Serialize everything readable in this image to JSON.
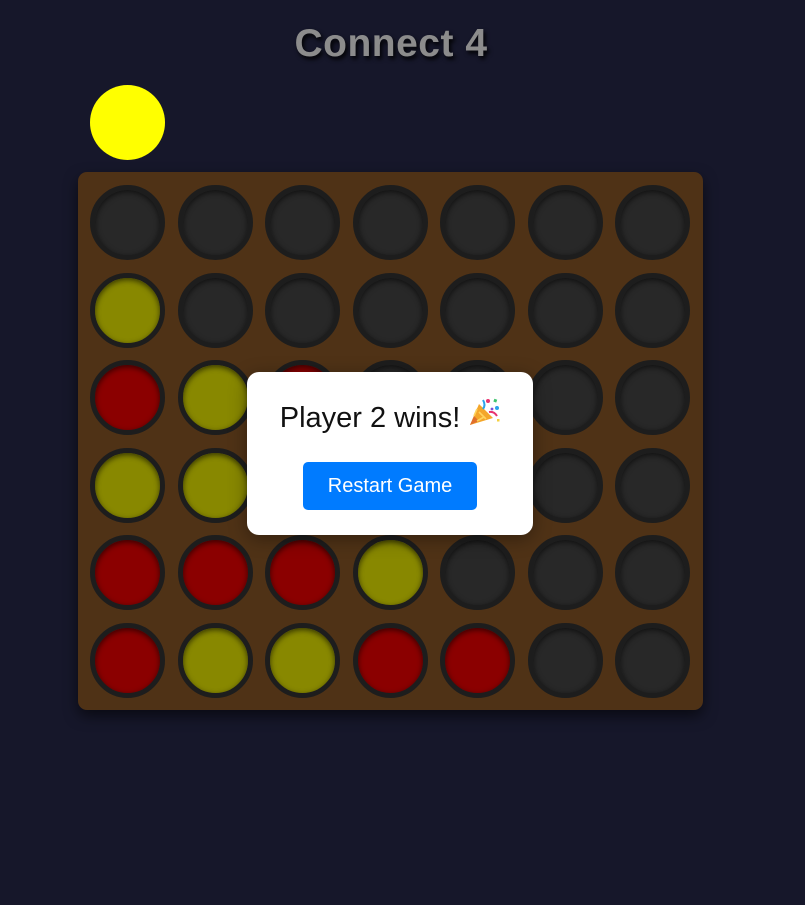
{
  "title": "Connect 4",
  "colors": {
    "background": "#16172a",
    "board": "#4f3216",
    "empty": "#282828",
    "player1": "#8b0000",
    "player2": "#888800",
    "current_piece": "#ffff00",
    "button": "#007bff"
  },
  "current_player": 2,
  "board": {
    "rows": 6,
    "cols": 7,
    "cells": [
      [
        0,
        0,
        0,
        0,
        0,
        0,
        0
      ],
      [
        2,
        0,
        0,
        0,
        0,
        0,
        0
      ],
      [
        1,
        2,
        1,
        0,
        0,
        0,
        0
      ],
      [
        2,
        2,
        0,
        0,
        0,
        0,
        0
      ],
      [
        1,
        1,
        1,
        2,
        0,
        0,
        0
      ],
      [
        1,
        2,
        2,
        1,
        1,
        0,
        0
      ]
    ]
  },
  "result": {
    "message": "Player 2 wins!",
    "icon": "party-popper-icon",
    "restart_label": "Restart Game"
  }
}
